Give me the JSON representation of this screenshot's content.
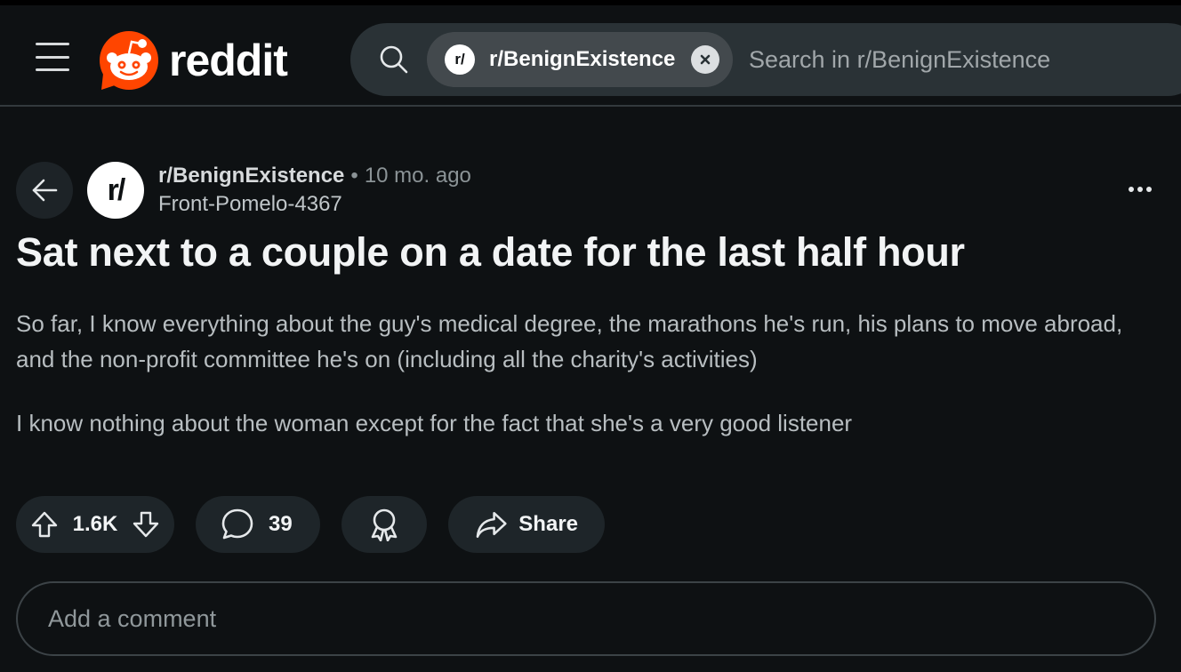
{
  "app": {
    "name": "reddit"
  },
  "search": {
    "chip_label": "r/BenignExistence",
    "chip_avatar": "r/",
    "placeholder": "Search in r/BenignExistence",
    "icons": [
      "search-icon",
      "close-icon"
    ]
  },
  "post": {
    "subreddit": "r/BenignExistence",
    "subreddit_avatar": "r/",
    "separator": "•",
    "time": "10 mo. ago",
    "author": "Front-Pomelo-4367",
    "title": "Sat next to a couple on a date for the last half hour",
    "body": [
      "So far, I know everything about the guy's medical degree, the marathons he's run, his plans to move abroad, and the non-profit committee he's on (including all the charity's activities)",
      "I know nothing about the woman except for the fact that she's a very good listener"
    ]
  },
  "actions": {
    "votes": "1.6K",
    "comments": "39",
    "share_label": "Share"
  },
  "comment_box": {
    "placeholder": "Add a comment"
  },
  "colors": {
    "background": "#0e1113",
    "brand": "#ff4500",
    "pill": "#1e2529",
    "search_bg": "#2a3236"
  }
}
